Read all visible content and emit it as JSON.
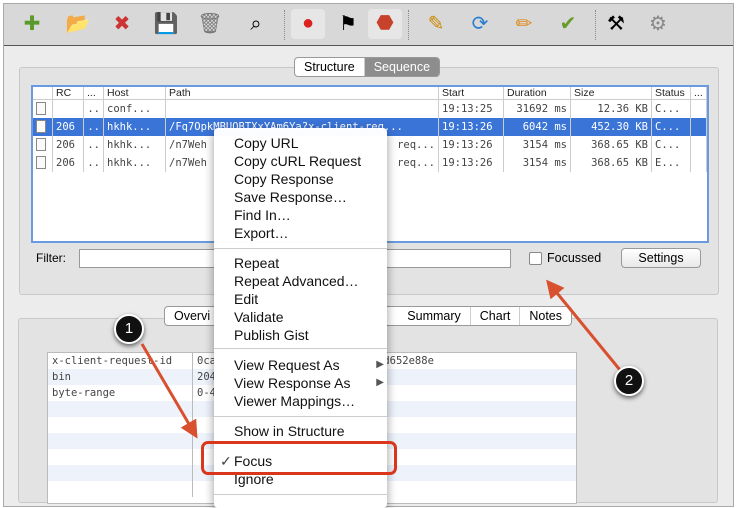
{
  "toolbar": {
    "icons": [
      "new-session-icon",
      "open-icon",
      "close-icon",
      "save-icon",
      "clear-icon",
      "find-icon",
      "record-icon",
      "checkered-flag-icon",
      "stop-icon",
      "edit-icon",
      "repeat-icon",
      "pencil-icon",
      "validate-icon",
      "tools-icon",
      "settings-gear-icon"
    ]
  },
  "view_tabs": {
    "structure": "Structure",
    "sequence": "Sequence",
    "selected": "Sequence"
  },
  "table": {
    "headers": [
      "RC",
      "...",
      "Host",
      "Path",
      "Start",
      "Duration",
      "Size",
      "Status",
      "..."
    ],
    "rows": [
      {
        "rc": "",
        "dots": "..",
        "host": "conf...",
        "path": "",
        "path_tail": "",
        "start": "19:13:25",
        "duration": "31692 ms",
        "size": "12.36 KB",
        "status": "C...",
        "selected": false
      },
      {
        "rc": "206",
        "dots": "..",
        "host": "hkhk...",
        "path": "/Fq7OpkMBUOBTXxYAm6Ya?x-client-req...",
        "path_tail": "",
        "start": "19:13:26",
        "duration": "6042 ms",
        "size": "452.30 KB",
        "status": "C...",
        "selected": true
      },
      {
        "rc": "206",
        "dots": "..",
        "host": "hkhk...",
        "path": "/n7Weh",
        "path_tail": "req...",
        "start": "19:13:26",
        "duration": "3154 ms",
        "size": "368.65 KB",
        "status": "C...",
        "selected": false
      },
      {
        "rc": "206",
        "dots": "..",
        "host": "hkhk...",
        "path": "/n7Weh",
        "path_tail": "req...",
        "start": "19:13:26",
        "duration": "3154 ms",
        "size": "368.65 KB",
        "status": "E...",
        "selected": false
      }
    ]
  },
  "filter": {
    "label": "Filter:",
    "value": "",
    "focussed_label": "Focussed",
    "focussed_checked": false,
    "settings_label": "Settings"
  },
  "detail_tabs": [
    "Overvi",
    "Summary",
    "Chart",
    "Notes"
  ],
  "detail_rows": [
    {
      "key": "x-client-request-id",
      "value": "0ca",
      "value_tail": "dd652e88e"
    },
    {
      "key": "bin",
      "value": "204",
      "value_tail": ""
    },
    {
      "key": "byte-range",
      "value": "0-4",
      "value_tail": ""
    }
  ],
  "context_menu": {
    "items": [
      "Copy URL",
      "Copy cURL Request",
      "Copy Response",
      "Save Response…",
      "Find In…",
      "Export…",
      "Repeat",
      "Repeat Advanced…",
      "Edit",
      "Validate",
      "Publish Gist",
      "View Request As",
      "View Response As",
      "Viewer Mappings…",
      "Show in Structure",
      "Focus",
      "Ignore"
    ],
    "checked": "Focus",
    "submenu_arrow": "▶",
    "check_mark": "✓"
  },
  "annotations": {
    "badge1": "1",
    "badge2": "2",
    "highlight_color": "#d9361c",
    "arrow_color": "#d9502f"
  },
  "colors": {
    "selection": "#3b74d7",
    "table_focus_border": "#6a9be0"
  }
}
